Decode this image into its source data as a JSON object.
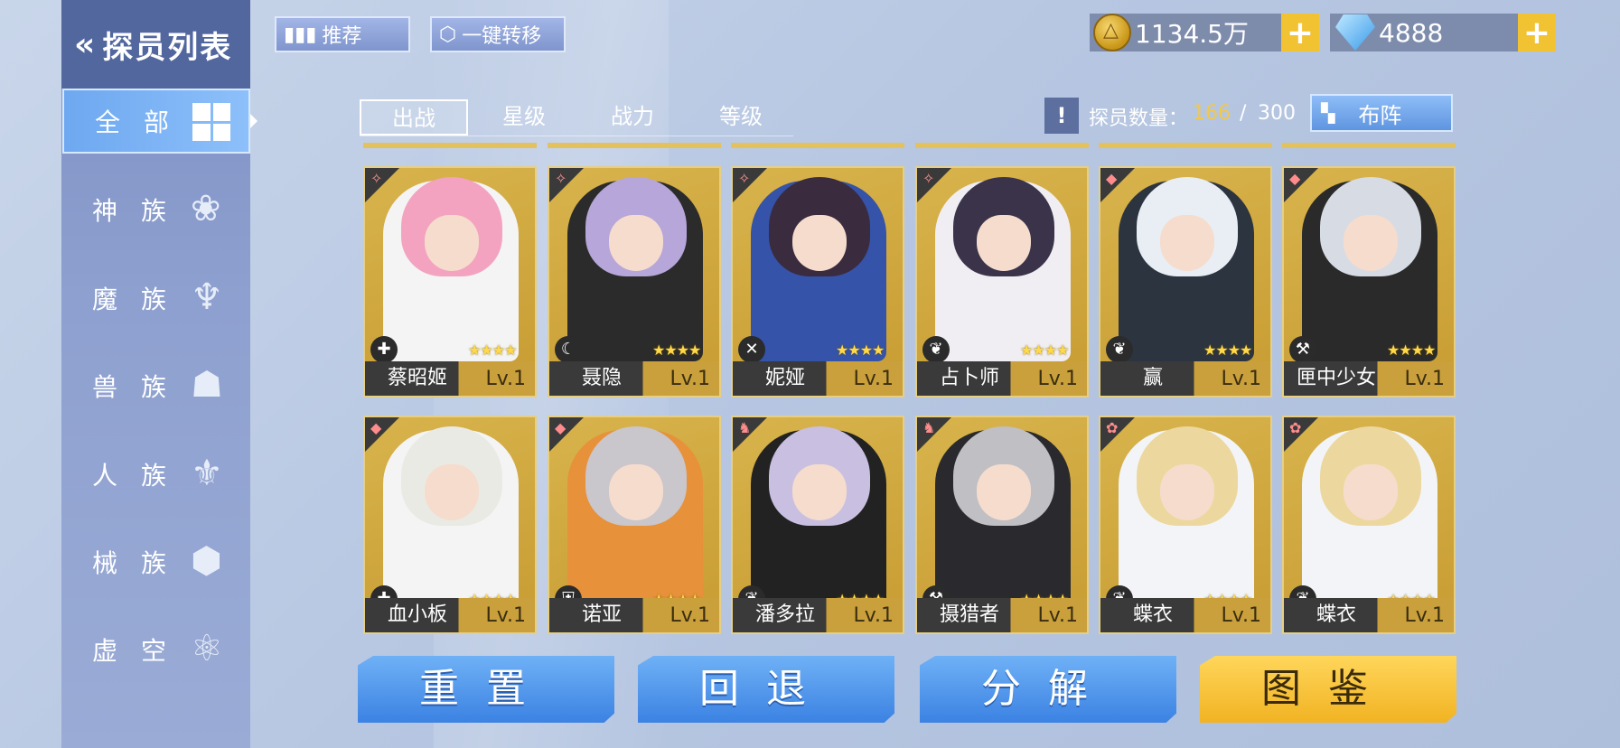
{
  "header": {
    "back_symbol": "«",
    "title": "探员列表",
    "recommend_icon": "▮▮▮",
    "recommend_label": "推荐",
    "transfer_icon": "⬡",
    "transfer_label": "一键转移"
  },
  "currency": {
    "gold": "1134.5万",
    "diamond": "4888",
    "plus": "+"
  },
  "sidebar": {
    "items": [
      {
        "label": "全部",
        "icon": "grid-icon"
      },
      {
        "label": "神族",
        "icon": "lotus-icon",
        "glyph": "❀"
      },
      {
        "label": "魔族",
        "icon": "demon-icon",
        "glyph": "♆"
      },
      {
        "label": "兽族",
        "icon": "beast-icon",
        "glyph": "☗"
      },
      {
        "label": "人族",
        "icon": "human-icon",
        "glyph": "⚜"
      },
      {
        "label": "械族",
        "icon": "mech-icon",
        "glyph": "⬢"
      },
      {
        "label": "虚空",
        "icon": "void-icon",
        "glyph": "⚛"
      }
    ]
  },
  "tabs": [
    "出战",
    "星级",
    "战力",
    "等级"
  ],
  "info_glyph": "!",
  "count": {
    "label": "探员数量：",
    "current": "166",
    "separator": "/",
    "max": "300"
  },
  "formation": {
    "icon": "▚",
    "label": "布阵"
  },
  "cards": [
    {
      "name": "蔡昭姬",
      "level": "Lv.1",
      "stars": "★★★★",
      "faction_glyph": "✧",
      "class_glyph": "✚",
      "hair": "#f3a3c0",
      "outfit": "#f4f4f4"
    },
    {
      "name": "聂隐",
      "level": "Lv.1",
      "stars": "★★★★",
      "faction_glyph": "✧",
      "class_glyph": "☾",
      "hair": "#b7a6d9",
      "outfit": "#2b2b2b"
    },
    {
      "name": "妮娅",
      "level": "Lv.1",
      "stars": "★★★★",
      "faction_glyph": "✧",
      "class_glyph": "✕",
      "hair": "#3a2b3e",
      "outfit": "#3553a8"
    },
    {
      "name": "占卜师",
      "level": "Lv.1",
      "stars": "★★★★",
      "faction_glyph": "✧",
      "class_glyph": "❦",
      "hair": "#3a334a",
      "outfit": "#f1eef3"
    },
    {
      "name": "赢",
      "level": "Lv.1",
      "stars": "★★★★",
      "faction_glyph": "◆",
      "class_glyph": "❦",
      "hair": "#e8eef4",
      "outfit": "#2c3440"
    },
    {
      "name": "匣中少女",
      "level": "Lv.1",
      "stars": "★★★★",
      "faction_glyph": "◆",
      "class_glyph": "⚒",
      "hair": "#d7dbe3",
      "outfit": "#2a2a2a"
    },
    {
      "name": "血小板",
      "level": "Lv.1",
      "stars": "★★★★",
      "faction_glyph": "◆",
      "class_glyph": "✚",
      "hair": "#eaeae4",
      "outfit": "#f4f4f4"
    },
    {
      "name": "诺亚",
      "level": "Lv.1",
      "stars": "★★★★",
      "faction_glyph": "◆",
      "class_glyph": "⛨",
      "hair": "#c9c6cc",
      "outfit": "#e7913a"
    },
    {
      "name": "潘多拉",
      "level": "Lv.1",
      "stars": "★★★★",
      "faction_glyph": "♞",
      "class_glyph": "❦",
      "hair": "#c9bfe0",
      "outfit": "#222222"
    },
    {
      "name": "摄猎者",
      "level": "Lv.1",
      "stars": "★★★★",
      "faction_glyph": "♞",
      "class_glyph": "⚒",
      "hair": "#bfbfc4",
      "outfit": "#2a2a2e"
    },
    {
      "name": "蝶衣",
      "level": "Lv.1",
      "stars": "★★★★",
      "faction_glyph": "✿",
      "class_glyph": "❦",
      "hair": "#ecd89e",
      "outfit": "#f2f4f8"
    },
    {
      "name": "蝶衣",
      "level": "Lv.1",
      "stars": "★★★★",
      "faction_glyph": "✿",
      "class_glyph": "❦",
      "hair": "#ecd89e",
      "outfit": "#f2f4f8"
    }
  ],
  "actions": [
    "重置",
    "回退",
    "分解",
    "图鉴"
  ]
}
